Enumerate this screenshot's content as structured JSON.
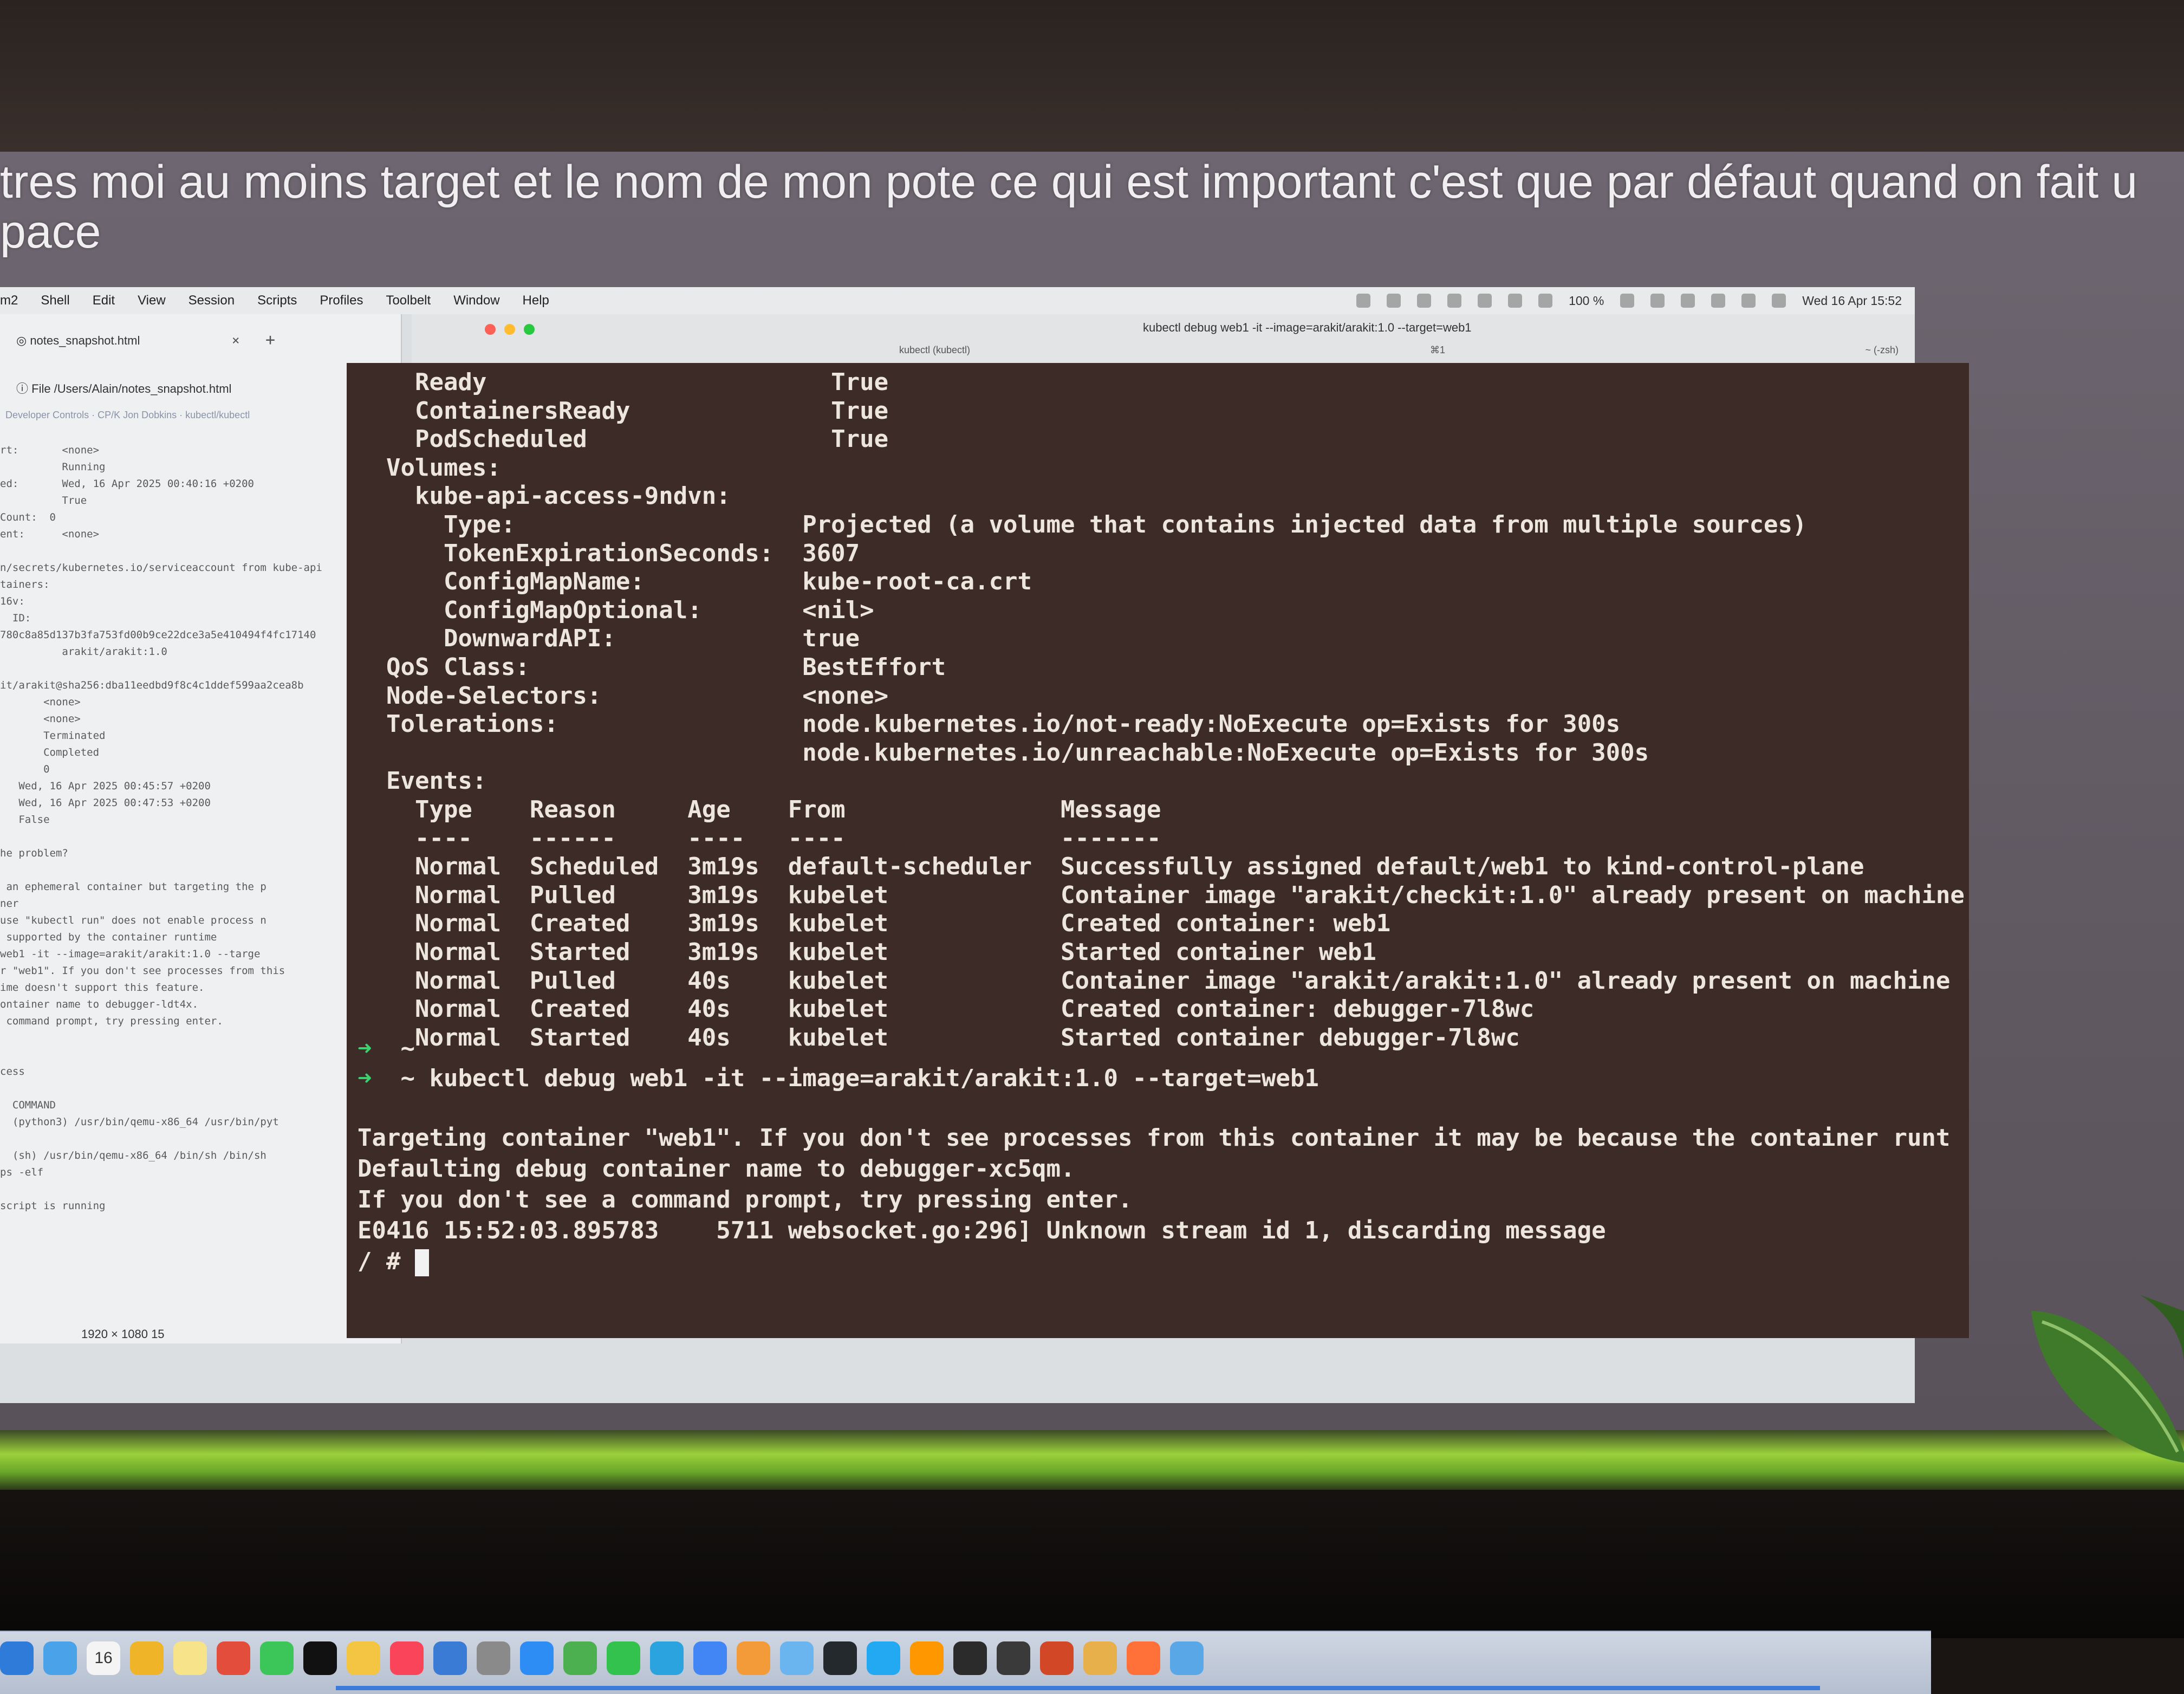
{
  "subtitle": {
    "line1": "tres moi au moins target et le nom de mon pote ce qui est important c'est que par défaut quand on fait u",
    "line2": "pace"
  },
  "menubar": {
    "items": [
      "m2",
      "Shell",
      "Edit",
      "View",
      "Session",
      "Scripts",
      "Profiles",
      "Toolbelt",
      "Window",
      "Help"
    ],
    "battery": "100 %",
    "datetime": "Wed 16 Apr  15:52"
  },
  "browser": {
    "tab_label": "notes_snapshot.html",
    "tab_close": "×",
    "tab_plus": "+",
    "url": "File   /Users/Alain/notes_snapshot.html",
    "bookmarks": "Developer Controls   ·   CP/K Jon Dobkins   ·   kubectl/kubectl",
    "lines": [
      "rt:       <none>",
      "          Running",
      "ed:       Wed, 16 Apr 2025 00:40:16 +0200",
      "          True",
      "Count:  0",
      "ent:      <none>",
      "",
      "n/secrets/kubernetes.io/serviceaccount from kube-api",
      "tainers:",
      "16v:",
      "  ID:",
      "780c8a85d137b3fa753fd00b9ce22dce3a5e410494f4fc17140",
      "          arakit/arakit:1.0",
      "",
      "it/arakit@sha256:dba11eedbd9f8c4c1ddef599aa2cea8b",
      "       <none>",
      "       <none>",
      "       Terminated",
      "       Completed",
      "       0",
      "   Wed, 16 Apr 2025 00:45:57 +0200",
      "   Wed, 16 Apr 2025 00:47:53 +0200",
      "   False",
      "",
      "he problem?",
      "",
      " an ephemeral container but targeting the p",
      "ner",
      "use \"kubectl run\" does not enable process n",
      " supported by the container runtime",
      "web1 -it --image=arakit/arakit:1.0 --targe",
      "r \"web1\". If you don't see processes from this",
      "ime doesn't support this feature.",
      "ontainer name to debugger-ldt4x.",
      " command prompt, try pressing enter.",
      "",
      "",
      "cess",
      "",
      "  COMMAND",
      "  (python3) /usr/bin/qemu-x86_64 /usr/bin/pyt",
      "",
      "  (sh) /usr/bin/qemu-x86_64 /bin/sh /bin/sh",
      "ps -elf",
      "",
      "script is running"
    ],
    "status": "1920 × 1080   15"
  },
  "terminal": {
    "title": "kubectl debug web1 -it --image=arakit/arakit:1.0 --target=web1",
    "tab": "kubectl (kubectl)",
    "shortcut": "⌘1",
    "shell": "~ (-zsh)",
    "lines": [
      "    Ready                        True",
      "    ContainersReady              True",
      "    PodScheduled                 True",
      "  Volumes:",
      "    kube-api-access-9ndvn:",
      "      Type:                    Projected (a volume that contains injected data from multiple sources)",
      "      TokenExpirationSeconds:  3607",
      "      ConfigMapName:           kube-root-ca.crt",
      "      ConfigMapOptional:       <nil>",
      "      DownwardAPI:             true",
      "  QoS Class:                   BestEffort",
      "  Node-Selectors:              <none>",
      "  Tolerations:                 node.kubernetes.io/not-ready:NoExecute op=Exists for 300s",
      "                               node.kubernetes.io/unreachable:NoExecute op=Exists for 300s",
      "  Events:",
      "    Type    Reason     Age    From               Message",
      "    ----    ------     ----   ----               -------",
      "    Normal  Scheduled  3m19s  default-scheduler  Successfully assigned default/web1 to kind-control-plane",
      "    Normal  Pulled     3m19s  kubelet            Container image \"arakit/checkit:1.0\" already present on machine",
      "    Normal  Created    3m19s  kubelet            Created container: web1",
      "    Normal  Started    3m19s  kubelet            Started container web1",
      "    Normal  Pulled     40s    kubelet            Container image \"arakit/arakit:1.0\" already present on machine",
      "    Normal  Created    40s    kubelet            Created container: debugger-7l8wc",
      "    Normal  Started    40s    kubelet            Started container debugger-7l8wc"
    ],
    "prompt_arrow": "➜",
    "prompt1": "  ~",
    "prompt2": "  ~ kubectl debug web1 -it --image=arakit/arakit:1.0 --target=web1",
    "out1": "Targeting container \"web1\". If you don't see processes from this container it may be because the container runt",
    "out2": "Defaulting debug container name to debugger-xc5qm.",
    "out3": "If you don't see a command prompt, try pressing enter.",
    "out4": "E0416 15:52:03.895783    5711 websocket.go:296] Unknown stream id 1, discarding message",
    "out5": "/ # "
  },
  "dock": {
    "icons": [
      "finder-icon",
      "safari-icon",
      "calendar-icon",
      "notes-icon",
      "stickies-icon",
      "chrome-icon",
      "facetime-icon",
      "appletv-icon",
      "photos-icon",
      "music-icon",
      "keynote-icon",
      "settings-icon",
      "appstore-icon",
      "robinhood-icon",
      "messages-icon",
      "telegram-icon",
      "chrome-alt-icon",
      "sublime-merge-icon",
      "preview-icon",
      "github-icon",
      "vscode-icon",
      "sublime-icon",
      "terminal-icon",
      "iterm-icon",
      "powerpoint-icon",
      "slack-icon",
      "firefox-icon",
      "finder-alt-icon"
    ],
    "calendar_day": "16",
    "colors": [
      "#2f7bd9",
      "#4aa3e8",
      "#f4f4f4",
      "#f0b429",
      "#f7e38a",
      "#e34d3b",
      "#3cc65a",
      "#111111",
      "#f4c542",
      "#fa4459",
      "#3a7bd5",
      "#8a8a8a",
      "#2e8cf5",
      "#4caf50",
      "#33c24d",
      "#2aa3de",
      "#4285f4",
      "#f29b38",
      "#6ab4f0",
      "#24292e",
      "#23a9f2",
      "#ff9800",
      "#2b2b2b",
      "#3a3a3a",
      "#d24726",
      "#e8b04a",
      "#ff7139",
      "#5aa7e8"
    ]
  }
}
